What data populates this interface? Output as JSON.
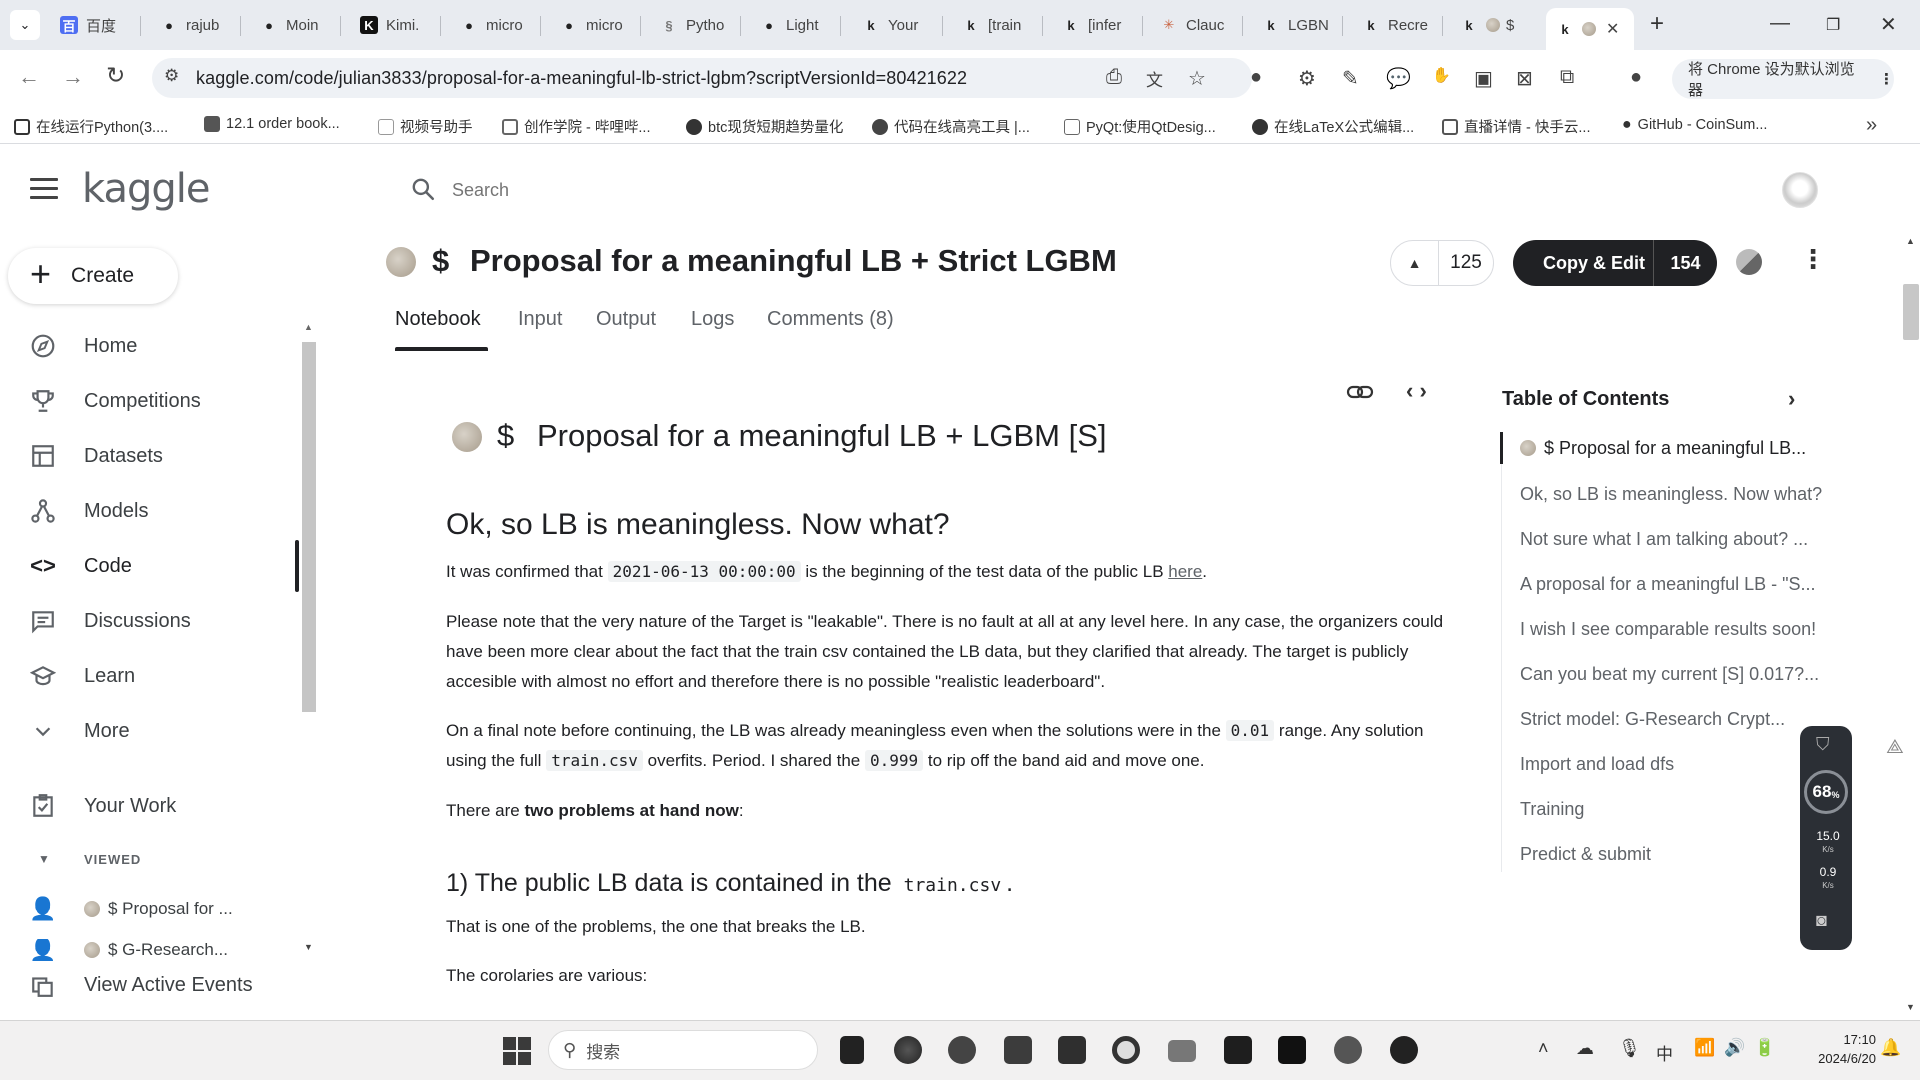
{
  "browser": {
    "tabs": [
      {
        "label": "百度",
        "icon": "baidu-icon"
      },
      {
        "label": "rajub",
        "icon": "github-icon"
      },
      {
        "label": "Moin",
        "icon": "github-icon"
      },
      {
        "label": "Kimi.",
        "icon": "kimi-icon"
      },
      {
        "label": "micro",
        "icon": "github-icon"
      },
      {
        "label": "micro",
        "icon": "github-icon"
      },
      {
        "label": "Pytho",
        "icon": "python-icon"
      },
      {
        "label": "Light",
        "icon": "github-icon"
      },
      {
        "label": "Your",
        "icon": "kaggle-icon"
      },
      {
        "label": "[train",
        "icon": "kaggle-icon"
      },
      {
        "label": "[infer",
        "icon": "kaggle-icon"
      },
      {
        "label": "Clauc",
        "icon": "claude-icon"
      },
      {
        "label": "LGBN",
        "icon": "kaggle-icon"
      },
      {
        "label": "Recre",
        "icon": "kaggle-icon"
      },
      {
        "label": "$",
        "icon": "kaggle-icon"
      },
      {
        "label": "",
        "icon": "kaggle-icon"
      }
    ],
    "url": "kaggle.com/code/julian3833/proposal-for-a-meaningful-lb-strict-lgbm?scriptVersionId=80421622",
    "default_browser_label": "将 Chrome 设为默认浏览器",
    "bookmarks": [
      {
        "label": "在线运行Python(3...."
      },
      {
        "label": "12.1 order book..."
      },
      {
        "label": "视频号助手"
      },
      {
        "label": "创作学院 - 哔哩哔..."
      },
      {
        "label": "btc现货短期趋势量化"
      },
      {
        "label": "代码在线高亮工具 |..."
      },
      {
        "label": "PyQt:使用QtDesig..."
      },
      {
        "label": "在线LaTeX公式编辑..."
      },
      {
        "label": "直播详情 - 快手云..."
      },
      {
        "label": "GitHub - CoinSum..."
      }
    ]
  },
  "kaggle": {
    "logo": "kaggle",
    "search_placeholder": "Search",
    "create_label": "Create",
    "nav": [
      {
        "label": "Home",
        "icon": "compass-icon"
      },
      {
        "label": "Competitions",
        "icon": "trophy-icon"
      },
      {
        "label": "Datasets",
        "icon": "table-icon"
      },
      {
        "label": "Models",
        "icon": "models-icon"
      },
      {
        "label": "Code",
        "icon": "code-icon"
      },
      {
        "label": "Discussions",
        "icon": "discussions-icon"
      },
      {
        "label": "Learn",
        "icon": "school-icon"
      },
      {
        "label": "More",
        "icon": "chevron-down-icon"
      }
    ],
    "your_work": "Your Work",
    "viewed_label": "VIEWED",
    "viewed_items": [
      "$ Proposal for ...",
      "$ G-Research..."
    ],
    "view_active_events": "View Active Events"
  },
  "notebook": {
    "title": "Proposal for a meaningful LB + Strict LGBM",
    "title_prefix": "$",
    "upvotes": "125",
    "copy_edit_label": "Copy & Edit",
    "copy_edit_count": "154",
    "tabs": [
      "Notebook",
      "Input",
      "Output",
      "Logs",
      "Comments (8)"
    ],
    "heading": "Proposal for a meaningful LB + LGBM [S]",
    "section1_title": "Ok, so LB is meaningless. Now what?",
    "p1_a": "It was confirmed that ",
    "p1_code": "2021-06-13 00:00:00",
    "p1_b": " is the beginning of the test data of the public LB ",
    "p1_link": "here",
    "p1_c": ".",
    "p2": "Please note that the very nature of the Target is \"leakable\". There is no fault at all at any level here. In any case, the organizers could have been more clear about the fact that the train csv contained the LB data, but they clarified that already. The target is publicly accesible with almost no effort and therefore there is no possible \"realistic leaderboard\".",
    "p3_a": "On a final note before continuing, the LB was already meaningless even when the solutions were in the ",
    "p3_code1": "0.01",
    "p3_b": " range. Any solution using the full ",
    "p3_code2": "train.csv",
    "p3_c": " overfits. Period. I shared the ",
    "p3_code3": "0.999",
    "p3_d": " to rip off the band aid and move one.",
    "p4_a": "There are ",
    "p4_bold": "two problems at hand now",
    "p4_b": ":",
    "section2_a": "1) The public LB data is contained in the ",
    "section2_code": "train.csv",
    "section2_b": ".",
    "p5": "That is one of the problems, the one that breaks the LB.",
    "p6": "The corolaries are various:"
  },
  "toc": {
    "title": "Table of Contents",
    "items": [
      "$  Proposal for a meaningful LB...",
      "Ok, so LB is meaningless. Now what?",
      "Not sure what I am talking about? ...",
      "A proposal for a meaningful LB - \"S...",
      "I wish I see comparable results soon!",
      "Can you beat my current [S] 0.017?...",
      "Strict model:  G-Research Crypt...",
      "Import and load dfs",
      "Training",
      "Predict & submit"
    ]
  },
  "net_widget": {
    "percent": "68",
    "percent_unit": "%",
    "up": "15.0",
    "up_unit": "K/s",
    "down": "0.9",
    "down_unit": "K/s"
  },
  "taskbar": {
    "search_placeholder": "搜索",
    "time": "17:10",
    "date": "2024/6/20",
    "ime": "中"
  }
}
